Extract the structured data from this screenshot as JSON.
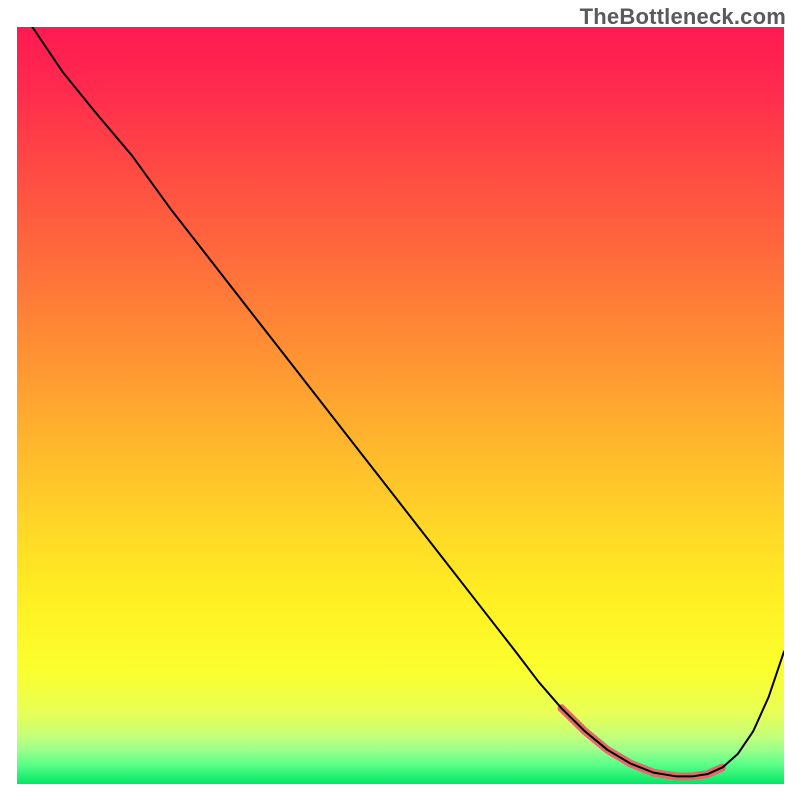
{
  "watermark": "TheBottleneck.com",
  "gradient_stops": [
    {
      "offset": 0.0,
      "color": "#ff1a52"
    },
    {
      "offset": 0.08,
      "color": "#ff2a4e"
    },
    {
      "offset": 0.18,
      "color": "#ff4844"
    },
    {
      "offset": 0.3,
      "color": "#ff6a3c"
    },
    {
      "offset": 0.42,
      "color": "#ff8e34"
    },
    {
      "offset": 0.54,
      "color": "#ffb32d"
    },
    {
      "offset": 0.66,
      "color": "#ffd727"
    },
    {
      "offset": 0.76,
      "color": "#fff023"
    },
    {
      "offset": 0.85,
      "color": "#fbff2e"
    },
    {
      "offset": 0.905,
      "color": "#e8ff55"
    },
    {
      "offset": 0.935,
      "color": "#c7ff78"
    },
    {
      "offset": 0.955,
      "color": "#9cff8c"
    },
    {
      "offset": 0.975,
      "color": "#58ff88"
    },
    {
      "offset": 1.0,
      "color": "#00e765"
    }
  ],
  "chart_data": {
    "type": "line",
    "title": "",
    "xlabel": "",
    "ylabel": "",
    "xlim": [
      0,
      100
    ],
    "ylim": [
      0,
      100
    ],
    "series": [
      {
        "name": "bottleneck-curve",
        "color": "#000000",
        "width": 2,
        "x": [
          2,
          6,
          10,
          15,
          20,
          25,
          30,
          35,
          40,
          45,
          50,
          55,
          60,
          65,
          68,
          71,
          74,
          77,
          80,
          83,
          86,
          88,
          90,
          92,
          94,
          96,
          98,
          100
        ],
        "y": [
          100,
          94,
          89,
          83,
          76,
          69.5,
          63,
          56.5,
          50,
          43.5,
          37,
          30.5,
          24,
          17.5,
          13.5,
          10,
          7,
          4.5,
          2.7,
          1.5,
          1.0,
          1.0,
          1.3,
          2.2,
          4.0,
          7.0,
          11.5,
          17.5
        ]
      }
    ],
    "highlight": {
      "name": "valley-highlight",
      "color": "#e46a6a",
      "width": 8,
      "x": [
        71,
        74,
        77,
        80,
        83,
        86,
        88,
        90,
        92
      ],
      "y": [
        10,
        7,
        4.5,
        2.7,
        1.5,
        1.0,
        1.0,
        1.3,
        2.2
      ]
    }
  }
}
